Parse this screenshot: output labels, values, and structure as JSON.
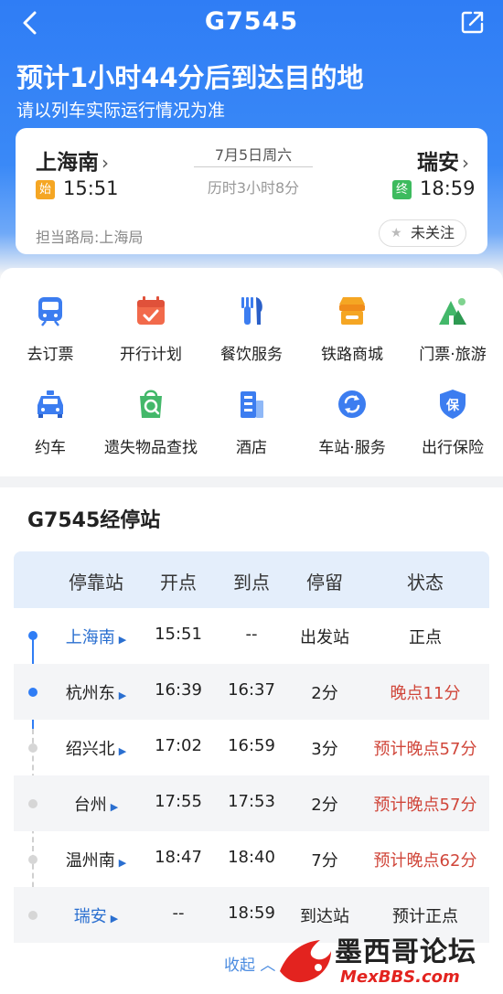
{
  "header": {
    "train_no": "G7545",
    "eta_text": "预计1小时44分后到达目的地",
    "eta_note": "请以列车实际运行情况为准"
  },
  "trip": {
    "from": {
      "name": "上海南",
      "badge": "始",
      "time": "15:51"
    },
    "to": {
      "name": "瑞安",
      "badge": "终",
      "time": "18:59"
    },
    "date": "7月5日周六",
    "duration": "历时3小时8分",
    "bureau": "担当路局:上海局",
    "follow_label": "未关注"
  },
  "services": [
    {
      "label": "去订票",
      "icon": "train-ticket-icon"
    },
    {
      "label": "开行计划",
      "icon": "calendar-icon"
    },
    {
      "label": "餐饮服务",
      "icon": "dining-icon"
    },
    {
      "label": "铁路商城",
      "icon": "shop-icon"
    },
    {
      "label": "门票·旅游",
      "icon": "mountain-icon"
    },
    {
      "label": "约车",
      "icon": "taxi-icon"
    },
    {
      "label": "遗失物品查找",
      "icon": "lost-found-icon"
    },
    {
      "label": "酒店",
      "icon": "hotel-icon"
    },
    {
      "label": "车站·服务",
      "icon": "station-service-icon"
    },
    {
      "label": "出行保险",
      "icon": "insurance-icon"
    }
  ],
  "stops": {
    "title": "G7545经停站",
    "columns": [
      "停靠站",
      "开点",
      "到点",
      "停留",
      "状态"
    ],
    "rows": [
      {
        "station": "上海南",
        "dep": "15:51",
        "arr": "--",
        "stay": "出发站",
        "status": "正点"
      },
      {
        "station": "杭州东",
        "dep": "16:39",
        "arr": "16:37",
        "stay": "2分",
        "status": "晚点11分"
      },
      {
        "station": "绍兴北",
        "dep": "17:02",
        "arr": "16:59",
        "stay": "3分",
        "status": "预计晚点57分"
      },
      {
        "station": "台州",
        "dep": "17:55",
        "arr": "17:53",
        "stay": "2分",
        "status": "预计晚点57分"
      },
      {
        "station": "温州南",
        "dep": "18:47",
        "arr": "18:40",
        "stay": "7分",
        "status": "预计晚点62分"
      },
      {
        "station": "瑞安",
        "dep": "--",
        "arr": "18:59",
        "stay": "到达站",
        "status": "预计正点"
      }
    ],
    "collapse_label": "收起"
  },
  "watermark": {
    "cn": "墨西哥论坛",
    "en": "MexBBS.com"
  },
  "colors": {
    "brand_blue": "#2f7df5",
    "late_red": "#d0463a",
    "station_blue": "#2a6fd0",
    "start_badge": "#f5a623",
    "end_badge": "#3dbb5e"
  }
}
